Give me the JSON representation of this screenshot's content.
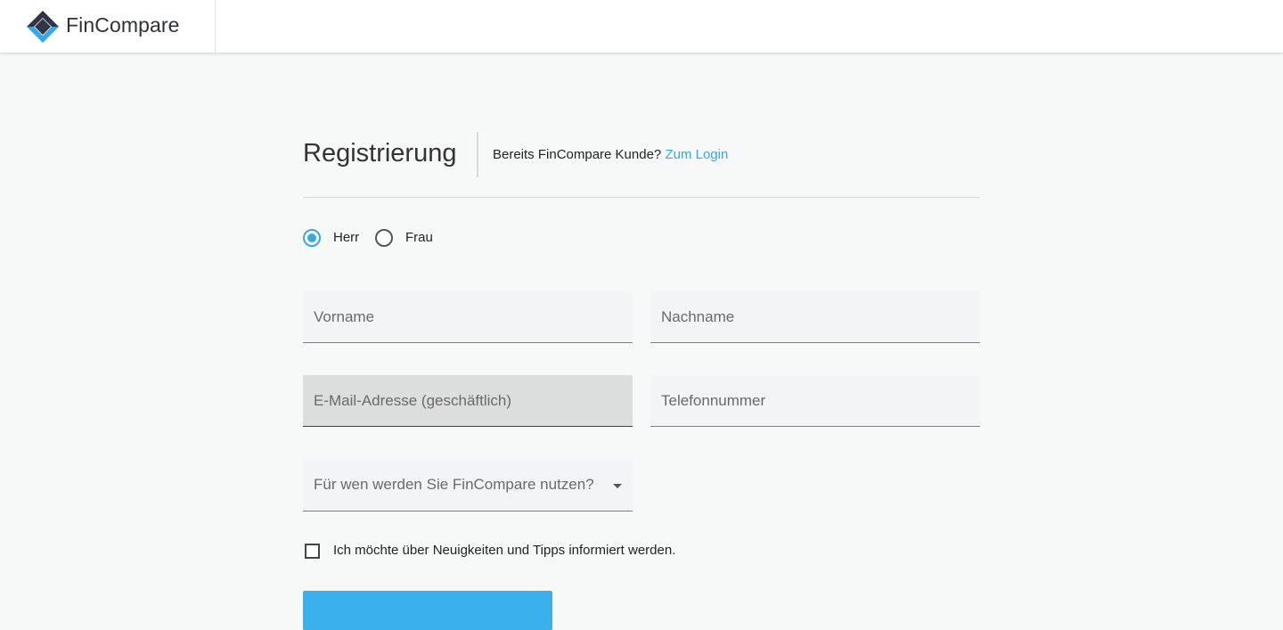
{
  "header": {
    "brand_name": "FinCompare",
    "logo_colors": {
      "dark": "#2f3542",
      "accent": "#37a8e3"
    }
  },
  "registration": {
    "title": "Registrierung",
    "login_hint_text": "Bereits FinCompare Kunde?",
    "login_link_label": "Zum Login",
    "salutation": {
      "selected": "Herr",
      "options": [
        {
          "label": "Herr",
          "checked": true
        },
        {
          "label": "Frau",
          "checked": false
        }
      ]
    },
    "fields": {
      "first_name": {
        "placeholder": "Vorname",
        "value": ""
      },
      "last_name": {
        "placeholder": "Nachname",
        "value": ""
      },
      "email": {
        "placeholder": "E-Mail-Adresse (geschäftlich)",
        "value": ""
      },
      "phone": {
        "placeholder": "Telefonnummer",
        "value": ""
      }
    },
    "usage_select": {
      "placeholder": "Für wen werden Sie FinCompare nutzen?",
      "icon": "caret-down-icon"
    },
    "newsletter": {
      "label": "Ich möchte über Neuigkeiten und Tipps informiert werden.",
      "checked": false
    }
  },
  "colors": {
    "accent": "#37a8e3",
    "button": "#3ab0ec",
    "page_background": "#f7f8f8",
    "field_background": "#f2f4f5",
    "focused_field_background": "#dcdddd"
  }
}
